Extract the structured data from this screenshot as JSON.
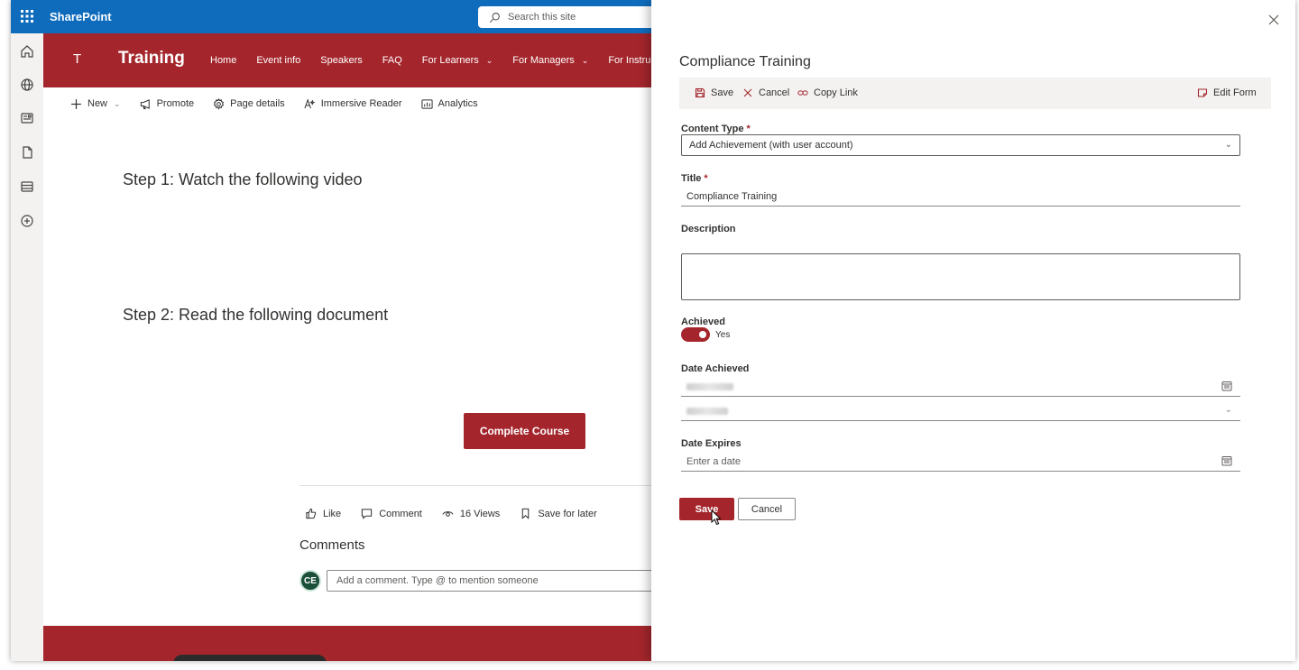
{
  "suitebar": {
    "brand": "SharePoint",
    "search_placeholder": "Search this site"
  },
  "site": {
    "logo_letter": "T",
    "title": "Training",
    "nav": [
      {
        "label": "Home",
        "has_chevron": false
      },
      {
        "label": "Event info",
        "has_chevron": false
      },
      {
        "label": "Speakers",
        "has_chevron": false
      },
      {
        "label": "FAQ",
        "has_chevron": false
      },
      {
        "label": "For Learners",
        "has_chevron": true
      },
      {
        "label": "For Managers",
        "has_chevron": true
      },
      {
        "label": "For Instructo",
        "has_chevron": false
      }
    ]
  },
  "commandbar": {
    "new": "New",
    "promote": "Promote",
    "page_details": "Page details",
    "immersive_reader": "Immersive Reader",
    "analytics": "Analytics"
  },
  "content": {
    "step1": "Step 1: Watch the following video",
    "step2": "Step 2: Read the following document",
    "complete_course": "Complete Course"
  },
  "social": {
    "like": "Like",
    "comment": "Comment",
    "views": "16 Views",
    "save_for_later": "Save for later",
    "comments_heading": "Comments",
    "comment_placeholder": "Add a comment. Type @ to mention someone"
  },
  "panel": {
    "title": "Compliance Training",
    "toolbar": {
      "save": "Save",
      "cancel": "Cancel",
      "copy_link": "Copy Link",
      "edit_form": "Edit Form"
    },
    "fields": {
      "content_type_label": "Content Type",
      "content_type_value": "Add Achievement (with user account)",
      "title_label": "Title",
      "title_value": "Compliance Training",
      "description_label": "Description",
      "achieved_label": "Achieved",
      "achieved_value": "Yes",
      "date_achieved_label": "Date Achieved",
      "date_expires_label": "Date Expires",
      "date_expires_placeholder": "Enter a date"
    },
    "buttons": {
      "save": "Save",
      "cancel": "Cancel"
    }
  },
  "colors": {
    "suitebar": "#0f6cbd",
    "brand_red": "#a4262c"
  }
}
